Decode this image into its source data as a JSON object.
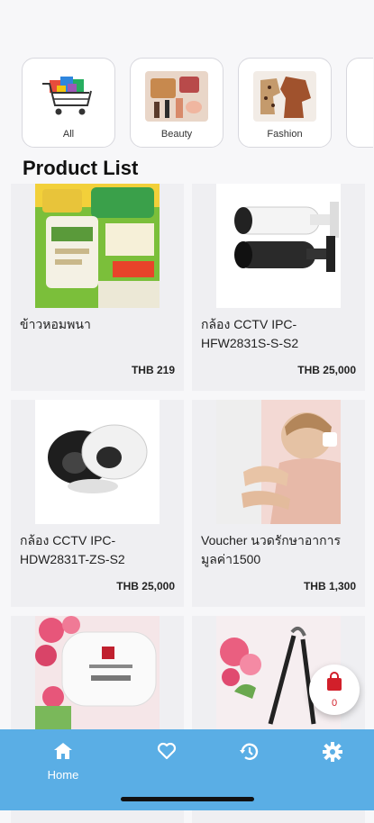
{
  "status_bar": {
    "time": "",
    "battery": ""
  },
  "categories": [
    {
      "label": "All",
      "icon": "shopping-cart-image"
    },
    {
      "label": "Beauty",
      "icon": "beauty-image"
    },
    {
      "label": "Fashion",
      "icon": "fashion-image"
    }
  ],
  "section_title": "Product List",
  "products": [
    {
      "name": "ข้าวหอมพนา",
      "price": "THB 219",
      "image": "rice-bag-image"
    },
    {
      "name": "กล้อง CCTV IPC-HFW2831S-S-S2",
      "price": "THB 25,000",
      "image": "bullet-camera-image"
    },
    {
      "name": "กล้อง CCTV IPC-HDW2831T-ZS-S2",
      "price": "THB 25,000",
      "image": "dome-camera-image"
    },
    {
      "name": "Voucher นวดรักษาอาการ มูลค่า1500",
      "price": "THB 1,300",
      "image": "massage-image"
    },
    {
      "name": "",
      "price": "",
      "image": "cosmetic-box-image"
    },
    {
      "name": "",
      "price": "",
      "image": "nail-tool-image"
    }
  ],
  "cart": {
    "count": "0",
    "icon": "shopping-bag-icon"
  },
  "tabbar": {
    "home_label": "Home",
    "items": [
      "home-icon",
      "heart-icon",
      "history-icon",
      "gear-icon"
    ]
  },
  "colors": {
    "tabbar": "#5aaee5",
    "cart_accent": "#d21f2a",
    "card_bg": "#efeff2"
  }
}
